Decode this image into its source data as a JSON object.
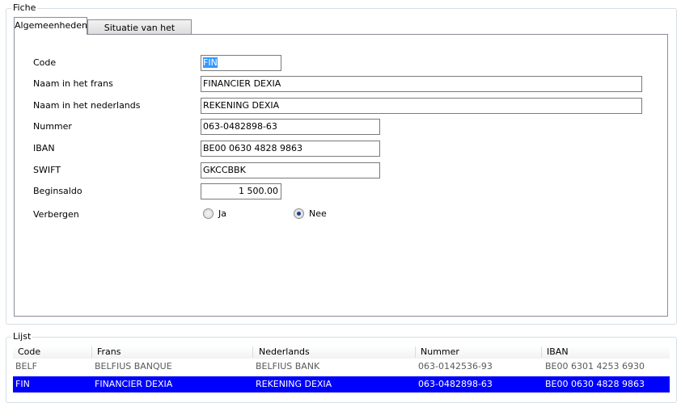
{
  "fiche": {
    "title": "Fiche",
    "tabs": [
      "Algemeenheden",
      "Situatie van het dagboek"
    ],
    "fields": {
      "code_label": "Code",
      "code_value": "FIN",
      "naam_fr_label": "Naam in het frans",
      "naam_fr_value": "FINANCIER DEXIA",
      "naam_nl_label": "Naam in het nederlands",
      "naam_nl_value": "REKENING DEXIA",
      "nummer_label": "Nummer",
      "nummer_value": "063-0482898-63",
      "iban_label": "IBAN",
      "iban_value": "BE00 0630 4828 9863",
      "swift_label": "SWIFT",
      "swift_value": "GKCCBBK",
      "beginsaldo_label": "Beginsaldo",
      "beginsaldo_value": "1 500.00",
      "verbergen_label": "Verbergen",
      "radio_ja": "Ja",
      "radio_nee": "Nee",
      "selected_radio": "Nee"
    }
  },
  "lijst": {
    "title": "Lijst",
    "columns": [
      "Code",
      "Frans",
      "Nederlands",
      "Nummer",
      "IBAN"
    ],
    "rows": [
      [
        "BELF",
        "BELFIUS BANQUE",
        "BELFIUS BANK",
        "063-0142536-93",
        "BE00 6301 4253 6930"
      ],
      [
        "FIN",
        "FINANCIER DEXIA",
        "REKENING DEXIA",
        "063-0482898-63",
        "BE00 0630 4828 9863"
      ]
    ],
    "selected_row": 1
  },
  "colors": {
    "selection": "#0000ff",
    "text_highlight": "#3399ff"
  }
}
